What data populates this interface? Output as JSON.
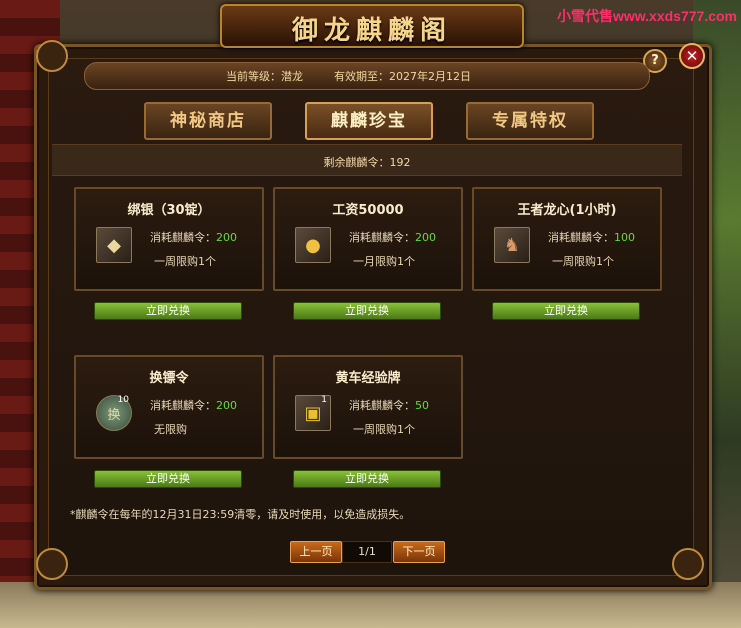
{
  "watermark": "小雪代售www.xxds777.com",
  "window_title": "御龙麒麟阁",
  "header": {
    "level_label": "当前等级：潜龙",
    "expiry_label": "有效期至：2027年2月12日"
  },
  "buttons": {
    "help": "?",
    "close": "✕"
  },
  "tabs": [
    {
      "label": "神秘商店",
      "active": false
    },
    {
      "label": "麒麟珍宝",
      "active": true
    },
    {
      "label": "专属特权",
      "active": false
    }
  ],
  "remaining": "剩余麒麟令：192",
  "cost_prefix": "消耗麒麟令：",
  "redeem_label": "立即兑换",
  "items": [
    {
      "name": "绑银（30锭）",
      "cost": "200",
      "limit": "一周限购1个",
      "icon": "silver-ingot-icon",
      "glyph": "◆",
      "badge": ""
    },
    {
      "name": "工资50000",
      "cost": "200",
      "limit": "一月限购1个",
      "icon": "gold-coins-icon",
      "glyph": "●",
      "badge": ""
    },
    {
      "name": "王者龙心(1小时)",
      "cost": "100",
      "limit": "一周限购1个",
      "icon": "dragon-heart-icon",
      "glyph": "♞",
      "badge": ""
    },
    {
      "name": "换镖令",
      "cost": "200",
      "limit": "无限购",
      "icon": "escort-token-icon",
      "glyph": "换",
      "badge": "10"
    },
    {
      "name": "黄车经验牌",
      "cost": "50",
      "limit": "一周限购1个",
      "icon": "yellow-cart-exp-icon",
      "glyph": "▣",
      "badge": "1"
    }
  ],
  "note": "*麒麟令在每年的12月31日23:59清零，请及时使用，以免造成损失。",
  "pagination": {
    "prev": "上一页",
    "page": "1/1",
    "next": "下一页"
  },
  "colors": {
    "accent_gold": "#f0c884",
    "cost_green": "#6ad83a",
    "redeem_green": "#6aa02a",
    "page_orange": "#c86a1a"
  }
}
